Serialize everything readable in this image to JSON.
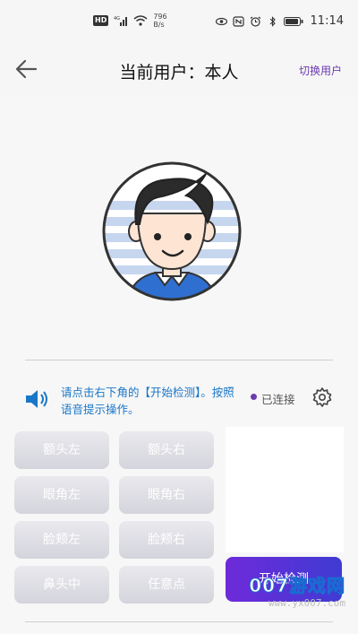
{
  "status_bar": {
    "hd": "HD",
    "network": "4G",
    "net_speed_value": "796",
    "net_speed_unit": "B/s",
    "time": "11:14"
  },
  "header": {
    "title": "当前用户：本人",
    "switch_user": "切换用户"
  },
  "hint": {
    "text": "请点击右下角的【开始检测】。按照语音提示操作。",
    "connection": "已连接"
  },
  "points": [
    {
      "label": "额头左"
    },
    {
      "label": "额头右"
    },
    {
      "label": "眼角左"
    },
    {
      "label": "眼角右"
    },
    {
      "label": "脸颊左"
    },
    {
      "label": "脸颊右"
    },
    {
      "label": "鼻头中"
    },
    {
      "label": "任意点"
    }
  ],
  "start_button": "开始检测",
  "watermark": {
    "main": "007游戏网",
    "url": "www.yx007.com"
  },
  "colors": {
    "accent": "#6b3bb0",
    "hint_blue": "#1a77c7",
    "button_gradient_start": "#6e2ad9",
    "button_gradient_end": "#3f3bd3"
  }
}
